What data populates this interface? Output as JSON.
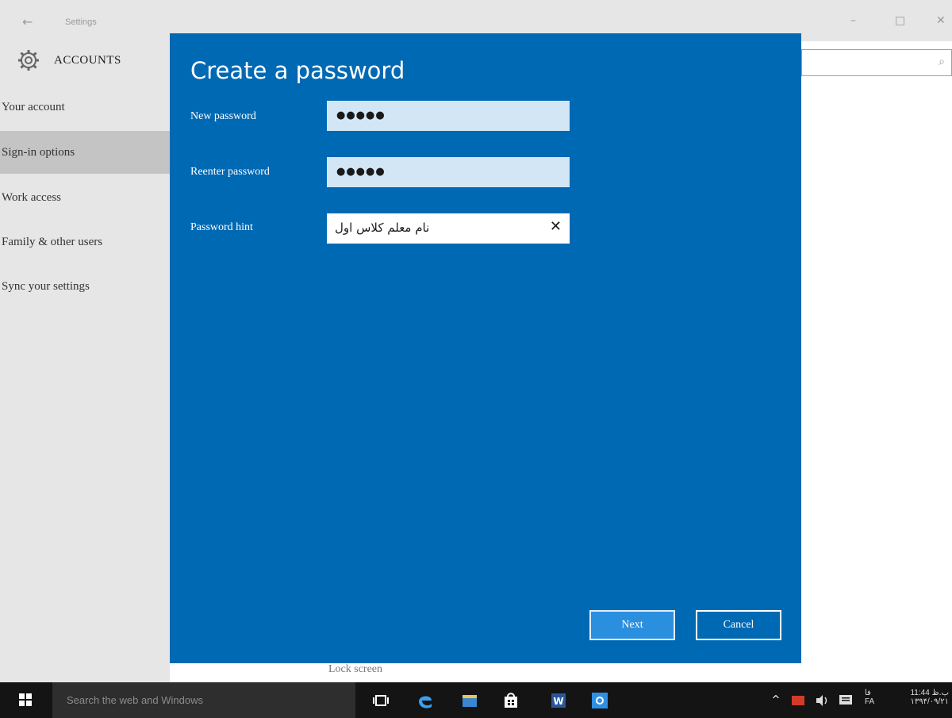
{
  "window": {
    "title": "Settings",
    "back_glyph": "←",
    "minimize_glyph": "–",
    "maximize_glyph": "□",
    "close_glyph": "✕"
  },
  "sidebar": {
    "header_title": "ACCOUNTS",
    "header_icon": "gear-icon",
    "items": [
      {
        "label": "Your account",
        "selected": false
      },
      {
        "label": "Sign-in options",
        "selected": true
      },
      {
        "label": "Work access",
        "selected": false
      },
      {
        "label": "Family & other users",
        "selected": false
      },
      {
        "label": "Sync your settings",
        "selected": false
      }
    ]
  },
  "main": {
    "search_icon_glyph": "⌕",
    "background_label": "Lock screen"
  },
  "dialog": {
    "title": "Create a password",
    "fields": {
      "new_password_label": "New password",
      "new_password_value": "●●●●●",
      "reenter_password_label": "Reenter password",
      "reenter_password_value": "●●●●●",
      "hint_label": "Password hint",
      "hint_value": "نام معلم کلاس اول",
      "clear_glyph": "✕"
    },
    "buttons": {
      "next_label": "Next",
      "cancel_label": "Cancel"
    },
    "colors": {
      "background": "#0069b4",
      "input_bg": "#d3e6f6"
    }
  },
  "taskbar": {
    "search_placeholder": "Search the web and Windows",
    "tray": {
      "language_top": "فا",
      "language_bottom": "FA",
      "time": "11:44 ب.ظ",
      "date": "۱۳۹۴/۰۹/۲۱"
    }
  }
}
